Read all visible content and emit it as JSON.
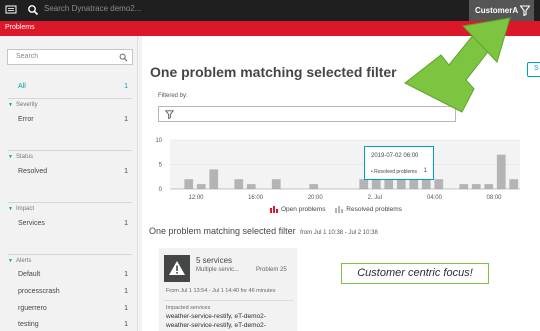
{
  "topbar": {
    "search_placeholder": "Search Dynatrace demo2...",
    "environment": "CustomerA",
    "menu_icon": "menu-icon",
    "search_icon": "search-icon",
    "filter_icon": "filter-icon"
  },
  "breadcrumb": {
    "label": "Problems"
  },
  "sidebar": {
    "search_placeholder": "Search",
    "all": {
      "label": "All",
      "count": "1"
    },
    "sections": {
      "severity": "Severity",
      "status": "Status",
      "impact": "Impact",
      "alerts": "Alerts"
    },
    "items": {
      "error": {
        "label": "Error",
        "count": "1"
      },
      "resolved": {
        "label": "Resolved",
        "count": "1"
      },
      "services": {
        "label": "Services",
        "count": "1"
      },
      "default": {
        "label": "Default",
        "count": "1"
      },
      "processcrash": {
        "label": "processcrash",
        "count": "1"
      },
      "rguerrero": {
        "label": "rguerrero",
        "count": "1"
      },
      "testing": {
        "label": "testing",
        "count": "1"
      }
    }
  },
  "main": {
    "title": "One problem matching selected filter",
    "edge_button": "S",
    "filtered_by_label": "Filtered by:",
    "subheading": "One problem matching selected filter",
    "subheading_range": "from Jul 1 10:38 - Jul 2 10:38"
  },
  "chart_data": {
    "type": "bar",
    "y_ticks": [
      "10",
      "5",
      "0"
    ],
    "ylim": [
      0,
      10
    ],
    "x_tick_labels": [
      "12:00",
      "16:00",
      "20:00",
      "2. Jul",
      "04:00",
      "08:00"
    ],
    "series": [
      {
        "name": "Open problems",
        "color": "#dc172a",
        "values": []
      },
      {
        "name": "Resolved problems",
        "color": "#b4b4b4",
        "values": [
          0,
          2,
          1,
          4,
          0,
          2,
          1,
          0,
          2,
          0,
          0,
          1,
          0,
          0,
          0,
          2,
          2,
          2,
          2,
          2,
          2,
          2,
          0,
          1,
          1,
          1,
          7,
          2
        ]
      }
    ],
    "tooltip": {
      "date": "2019-07-02 06:00",
      "label": "• Resolved problems",
      "value": "1"
    }
  },
  "card": {
    "title": "5 services",
    "subtitle": "Multiple servic...",
    "problem_id": "Problem 25",
    "timing": "From Jul 1 13:54 - Jul 1 14:40 for 46 minutes",
    "impacted_label": "Impacted services",
    "services": [
      "weather-service-restify, eT-demo2-",
      "weather-service-restify, eT-demo2-"
    ],
    "icon": "warning-icon"
  },
  "callout": {
    "text": "Customer centric focus!",
    "color": "#7dc540"
  },
  "arrow": {
    "color": "#7dc540"
  }
}
